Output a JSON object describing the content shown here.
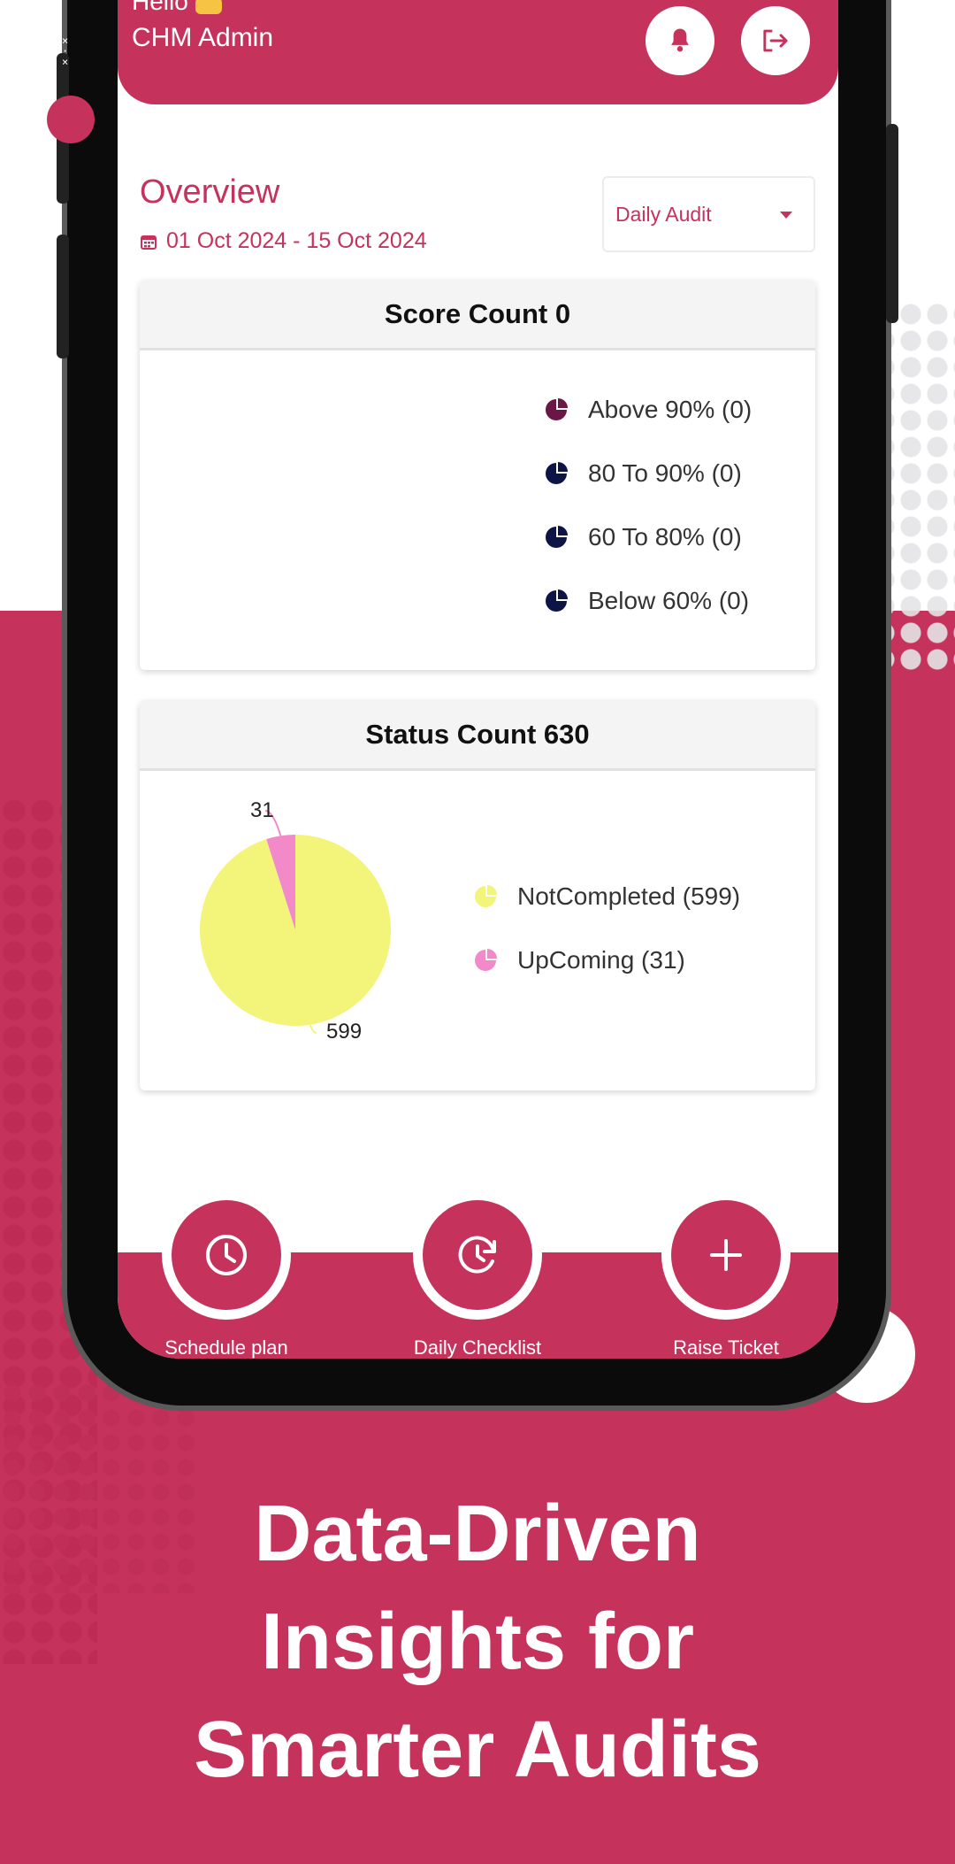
{
  "header": {
    "greeting": "Hello",
    "user_name": "CHM Admin",
    "notification_icon": "bell-icon",
    "logout_icon": "logout-icon"
  },
  "overview": {
    "title": "Overview",
    "date_range": "01 Oct 2024 - 15 Oct 2024",
    "calendar_icon": "calendar-icon",
    "dropdown_selected": "Daily Audit"
  },
  "score_card": {
    "title": "Score Count 0",
    "legend": [
      {
        "label": "Above 90% (0)",
        "color": "#6b1746"
      },
      {
        "label": "80 To 90% (0)",
        "color": "#0d1547"
      },
      {
        "label": "60 To 80% (0)",
        "color": "#0d1547"
      },
      {
        "label": "Below 60% (0)",
        "color": "#0d1547"
      }
    ]
  },
  "status_card": {
    "title": "Status Count 630",
    "legend": [
      {
        "label": "NotCompleted (599)",
        "color": "#f3f47a"
      },
      {
        "label": "UpComing (31)",
        "color": "#f28ac9"
      }
    ]
  },
  "chart_data": {
    "type": "pie",
    "title": "Status Count 630",
    "categories": [
      "NotCompleted",
      "UpComing"
    ],
    "values": [
      599,
      31
    ],
    "colors": [
      "#f3f47a",
      "#f28ac9"
    ],
    "data_labels": [
      "599",
      "31"
    ]
  },
  "nav": {
    "items": [
      {
        "label": "Schedule plan",
        "icon": "clock-icon"
      },
      {
        "label": "Daily Checklist",
        "icon": "refresh-clock-icon"
      },
      {
        "label": "Raise Ticket",
        "icon": "plus-icon"
      }
    ]
  },
  "tagline": {
    "line1": "Data-Driven",
    "line2": "Insights for",
    "line3": "Smarter Audits"
  },
  "colors": {
    "brand": "#c5335d",
    "background": "#ffffff"
  }
}
